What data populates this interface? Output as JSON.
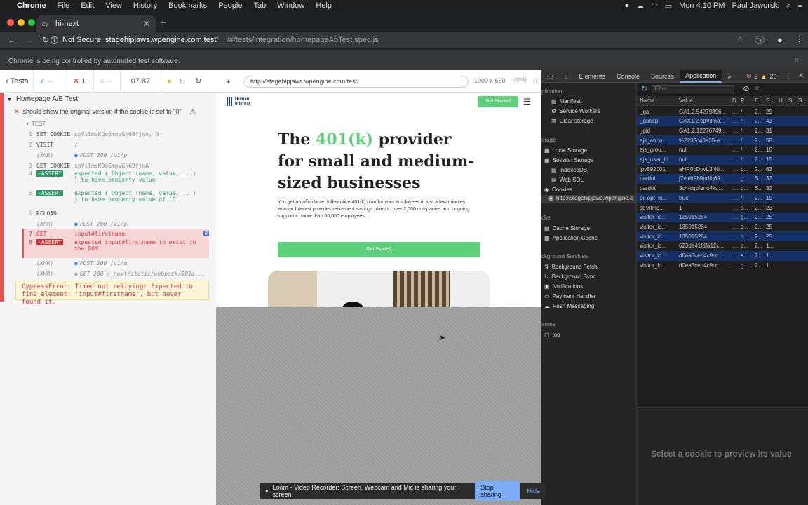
{
  "menubar": {
    "app": "Chrome",
    "items": [
      "File",
      "Edit",
      "View",
      "History",
      "Bookmarks",
      "People",
      "Tab",
      "Window",
      "Help"
    ],
    "clock": "Mon 4:10 PM",
    "user": "Paul Jaworski"
  },
  "tab": {
    "title": "hi-next",
    "favicon": "cy"
  },
  "address": {
    "security": "Not Secure",
    "host": "stagehipjaws.wpengine.com.test",
    "path": "/__/#/tests/integration/homepageAbTest.spec.js"
  },
  "banner": "Chrome is being controlled by automated test software.",
  "cypress": {
    "tests_label": "Tests",
    "passed": "--",
    "failed": "1",
    "pending": "--",
    "duration": "07.87",
    "suite": "Homepage A/B Test",
    "test": "should show the original version if the cookie is set to \"0\"",
    "section": "TEST",
    "commands": [
      {
        "n": "1",
        "k": "SET COOKIE",
        "v": "spVilmoKQo6mnvGh69fjnA, 0"
      },
      {
        "n": "2",
        "k": "VISIT",
        "v": "/"
      },
      {
        "n": "",
        "k": "(XHR)",
        "v": "POST 200 /v1/p"
      },
      {
        "n": "3",
        "k": "GET COOKIE",
        "v": "spVilmoKQo6mnvGh69fjnA"
      },
      {
        "n": "4",
        "k": "-ASSERT",
        "v": "expected { Object (name, value, ...)\n} to have property value"
      },
      {
        "n": "5",
        "k": "-ASSERT",
        "v": "expected { Object (name, value, ...)\n} to have property value of '0'"
      },
      {
        "n": "6",
        "k": "RELOAD",
        "v": ""
      },
      {
        "n": "",
        "k": "(XHR)",
        "v": "POST 200 /v1/p"
      },
      {
        "n": "7",
        "k": "GET",
        "v": "input#firstname"
      },
      {
        "n": "8",
        "k": "-ASSERT",
        "v": "expected input#firstname to exist in\nthe DOM"
      },
      {
        "n": "",
        "k": "(XHR)",
        "v": "POST 200 /v1/m"
      },
      {
        "n": "",
        "k": "(XHR)",
        "v": "GET 200 /_next/static/webpack/801a..."
      }
    ],
    "error": "CypressError: Timed out retrying: Expected to find element: 'input#firstname', but never found it."
  },
  "app": {
    "url": "http://stagehipjaws.wpengine.com.test/",
    "viewport": "1000 x 660",
    "zoom": "(67%)",
    "logo": "Human Interest",
    "cta": "Get Started",
    "headline_a": "The ",
    "headline_hl": "401(k)",
    "headline_b": " provider for small and medium-sized businesses",
    "body": "You get an affordable, full-service 401(k) plan for your employees in just a few minutes. Human Interest provides retirement savings plans to over 2,000 companies and ongoing support to more than 60,000 employees.",
    "green": "#5ed07c"
  },
  "devtools": {
    "tabs": [
      "Elements",
      "Console",
      "Sources",
      "Application"
    ],
    "errors": "2",
    "warnings": "28",
    "filter_placeholder": "Filter",
    "side": [
      {
        "t": "plication",
        "h": true
      },
      {
        "t": "Manifest"
      },
      {
        "t": "Service Workers"
      },
      {
        "t": "Clear storage"
      },
      {
        "t": "orage",
        "h": true
      },
      {
        "t": "Local Storage"
      },
      {
        "t": "Session Storage"
      },
      {
        "t": "IndexedDB"
      },
      {
        "t": "Web SQL"
      },
      {
        "t": "Cookies"
      },
      {
        "t": "http://stagehipjaws.wpengine.c"
      },
      {
        "t": "che",
        "h": true
      },
      {
        "t": "Cache Storage"
      },
      {
        "t": "Application Cache"
      },
      {
        "t": "ckground Services",
        "h": true
      },
      {
        "t": "Background Fetch"
      },
      {
        "t": "Background Sync"
      },
      {
        "t": "Notifications"
      },
      {
        "t": "Payment Handler"
      },
      {
        "t": "Push Messaging"
      },
      {
        "t": "ames",
        "h": true
      },
      {
        "t": "top"
      }
    ],
    "columns": [
      "Name",
      "Value",
      "D.",
      "P.",
      "E.",
      "S.",
      "H.",
      "S.",
      "S."
    ],
    "rows": [
      {
        "name": "_ga",
        "value": "GA1.2.54279896...",
        "p": "/",
        "e": "2...",
        "s": "29",
        "sel": false
      },
      {
        "name": "_gaexp",
        "value": "GAX1.2.spVilmo...",
        "p": "/",
        "e": "2...",
        "s": "43",
        "sel": true
      },
      {
        "name": "_gid",
        "value": "GA1.2.12276749...",
        "p": "/",
        "e": "2...",
        "s": "31",
        "sel": false
      },
      {
        "name": "ajs_anon...",
        "value": "%2233c40a35-e...",
        "p": "/",
        "e": "2...",
        "s": "58",
        "sel": true
      },
      {
        "name": "ajs_grou...",
        "value": "null",
        "p": "/",
        "e": "2...",
        "s": "16",
        "sel": false
      },
      {
        "name": "ajs_user_id",
        "value": "null",
        "p": "/",
        "e": "2...",
        "s": "15",
        "sel": true
      },
      {
        "name": "lpv592001",
        "value": "aHR0cDovL3N0...",
        "p": "p...",
        "e": "2...",
        "s": "63",
        "sel": false
      },
      {
        "name": "pardot",
        "value": "j7vtek9b9pdfq69...",
        "p": "g...",
        "e": "S...",
        "s": "32",
        "sel": true
      },
      {
        "name": "pardot",
        "value": "3c4tcqbfeno4ku...",
        "p": "p...",
        "e": "S...",
        "s": "32",
        "sel": false
      },
      {
        "name": "pi_opt_in...",
        "value": "true",
        "p": "/",
        "e": "2...",
        "s": "19",
        "sel": true
      },
      {
        "name": "spVilmo...",
        "value": "1",
        "p": "s...",
        "e": "2...",
        "s": "23",
        "sel": false
      },
      {
        "name": "visitor_id...",
        "value": "135015284",
        "p": "g...",
        "e": "2...",
        "s": "25",
        "sel": true
      },
      {
        "name": "visitor_id...",
        "value": "135015284",
        "p": "s...",
        "e": "2...",
        "s": "25",
        "sel": false
      },
      {
        "name": "visitor_id...",
        "value": "135015284",
        "p": "p...",
        "e": "2...",
        "s": "25",
        "sel": true
      },
      {
        "name": "visitor_id...",
        "value": "623de41fdfa12c...",
        "p": "p...",
        "e": "2...",
        "s": "1...",
        "sel": false
      },
      {
        "name": "visitor_id...",
        "value": "d0ea3ced4c9cc...",
        "p": "s...",
        "e": "2...",
        "s": "1...",
        "sel": true
      },
      {
        "name": "visitor_id...",
        "value": "d0ea3ced4c9cc...",
        "p": "g...",
        "e": "2...",
        "s": "1...",
        "sel": false
      }
    ],
    "preview": "Select a cookie to preview its value"
  },
  "loom": {
    "message": "Loom - Video Recorder: Screen, Webcam and Mic is sharing your screen.",
    "stop": "Stop sharing",
    "hide": "Hide"
  }
}
